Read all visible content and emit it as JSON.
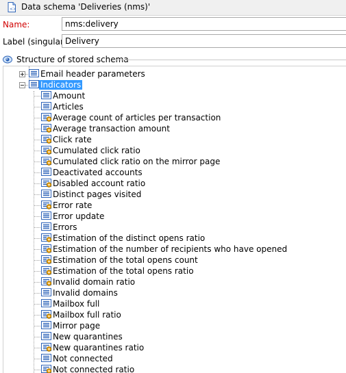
{
  "window": {
    "title": "Data schema 'Deliveries (nms)'"
  },
  "form": {
    "name_label": "Name:",
    "name_value": "nms:delivery",
    "label_label": "Label (singular):",
    "label_value": "Delivery"
  },
  "structure": {
    "title": "Structure of stored schema",
    "groups": [
      {
        "label": "Email header parameters",
        "expanded": false
      },
      {
        "label": "Indicators",
        "expanded": true,
        "selected": true
      }
    ],
    "items": [
      {
        "label": "Amount",
        "type": "field"
      },
      {
        "label": "Articles",
        "type": "field"
      },
      {
        "label": "Average count of articles per transaction",
        "type": "computed"
      },
      {
        "label": "Average transaction amount",
        "type": "computed"
      },
      {
        "label": "Click rate",
        "type": "computed"
      },
      {
        "label": "Cumulated click ratio",
        "type": "computed"
      },
      {
        "label": "Cumulated click ratio on the mirror page",
        "type": "computed"
      },
      {
        "label": "Deactivated accounts",
        "type": "field"
      },
      {
        "label": "Disabled account ratio",
        "type": "computed"
      },
      {
        "label": "Distinct pages visited",
        "type": "field"
      },
      {
        "label": "Error rate",
        "type": "computed"
      },
      {
        "label": "Error update",
        "type": "field"
      },
      {
        "label": "Errors",
        "type": "field"
      },
      {
        "label": "Estimation of the distinct opens ratio",
        "type": "computed"
      },
      {
        "label": "Estimation of the number of recipients who have opened",
        "type": "computed"
      },
      {
        "label": "Estimation of the total opens count",
        "type": "computed"
      },
      {
        "label": "Estimation of the total opens ratio",
        "type": "computed"
      },
      {
        "label": "Invalid domain ratio",
        "type": "computed"
      },
      {
        "label": "Invalid domains",
        "type": "field"
      },
      {
        "label": "Mailbox full",
        "type": "field"
      },
      {
        "label": "Mailbox full ratio",
        "type": "computed"
      },
      {
        "label": "Mirror page",
        "type": "field"
      },
      {
        "label": "New quarantines",
        "type": "field"
      },
      {
        "label": "New quarantines ratio",
        "type": "computed"
      },
      {
        "label": "Not connected",
        "type": "field"
      },
      {
        "label": "Not connected ratio",
        "type": "computed"
      }
    ]
  },
  "colors": {
    "required_label": "#d00000",
    "selection": "#3399ff",
    "icon_blue": "#2d63b8",
    "computed_badge": "#e8a317"
  }
}
